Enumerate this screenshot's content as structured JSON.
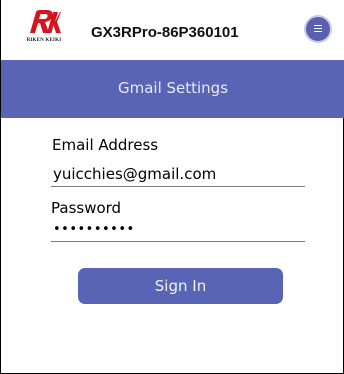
{
  "app": {
    "logo_text": "RIKEN KEIKI",
    "logo_icon": "riken-keiki-logo-icon",
    "device_name": "GX3RPro-86P360101",
    "menu_icon": "menu-icon"
  },
  "page": {
    "title": "Gmail Settings"
  },
  "form": {
    "email_label": "Email Address",
    "email_value": "yuicchies@gmail.com",
    "password_label": "Password",
    "password_value": "••••••••••",
    "signin_label": "Sign In"
  },
  "colors": {
    "accent": "#5a64b4",
    "logo_red": "#d7141e"
  }
}
